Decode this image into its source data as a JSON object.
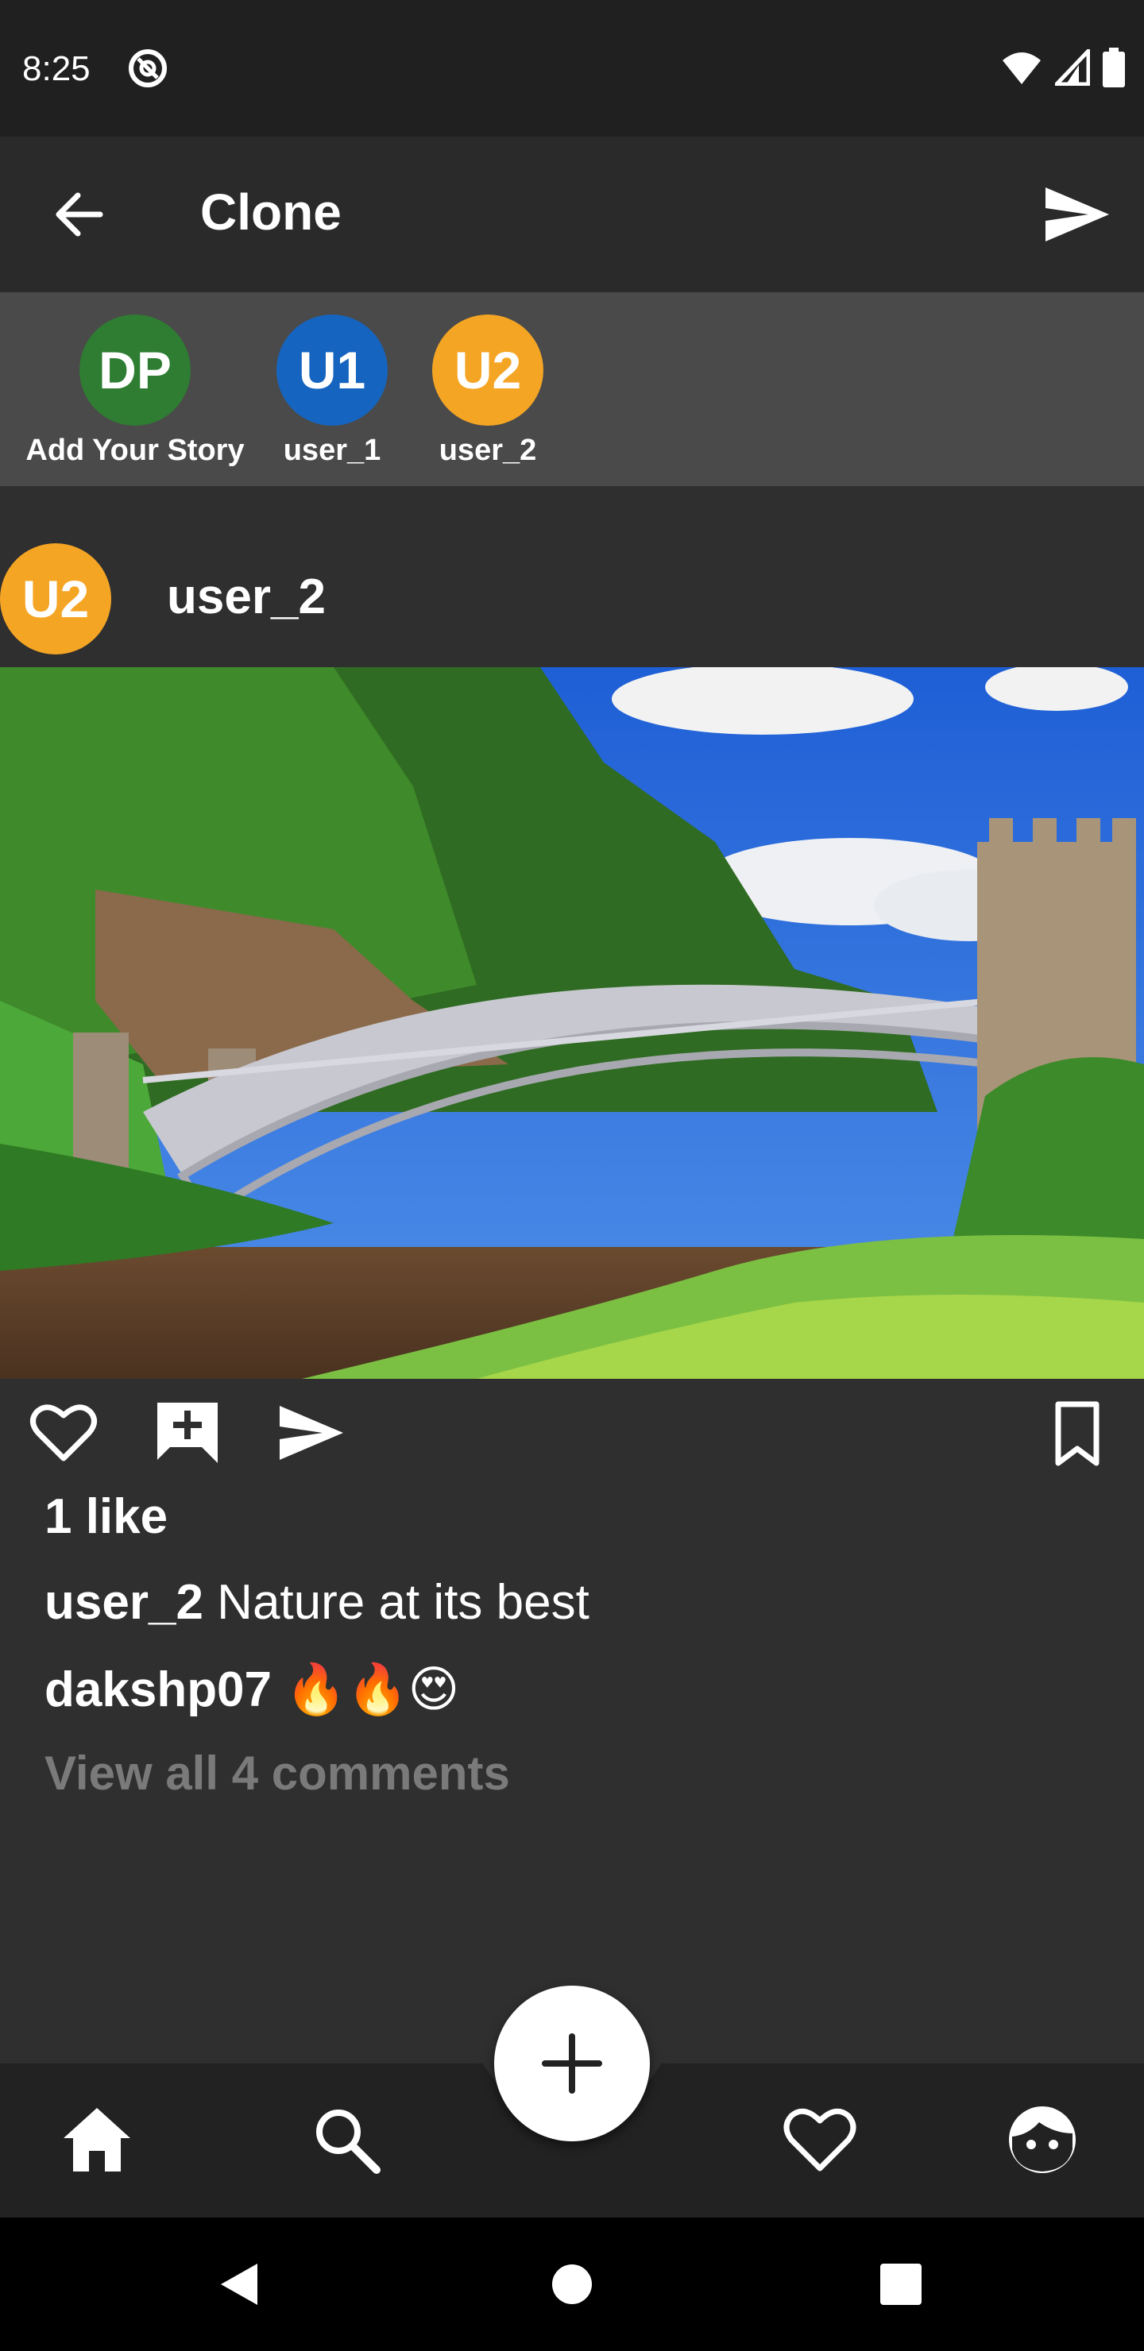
{
  "status_bar": {
    "time": "8:25"
  },
  "app_bar": {
    "title": "Clone"
  },
  "stories": [
    {
      "initials": "DP",
      "label": "Add Your Story",
      "color": "#2e7d32"
    },
    {
      "initials": "U1",
      "label": "user_1",
      "color": "#1565c0"
    },
    {
      "initials": "U2",
      "label": "user_2",
      "color": "#f5a524"
    }
  ],
  "post": {
    "avatar_initials": "U2",
    "username": "user_2",
    "likes": "1 like",
    "caption_user": "user_2",
    "caption_text": "Nature at its best",
    "comment_user": "dakshp07",
    "comment_text": "🔥🔥😍",
    "view_comments": "View all 4 comments"
  },
  "bottom_nav": {
    "items": [
      "home-icon",
      "search-icon",
      "add-icon",
      "heart-icon",
      "profile-icon"
    ]
  },
  "colors": {
    "background": "#2f2f2f",
    "accent_orange": "#f5a524",
    "accent_blue": "#1565c0",
    "accent_green": "#2e7d32"
  }
}
